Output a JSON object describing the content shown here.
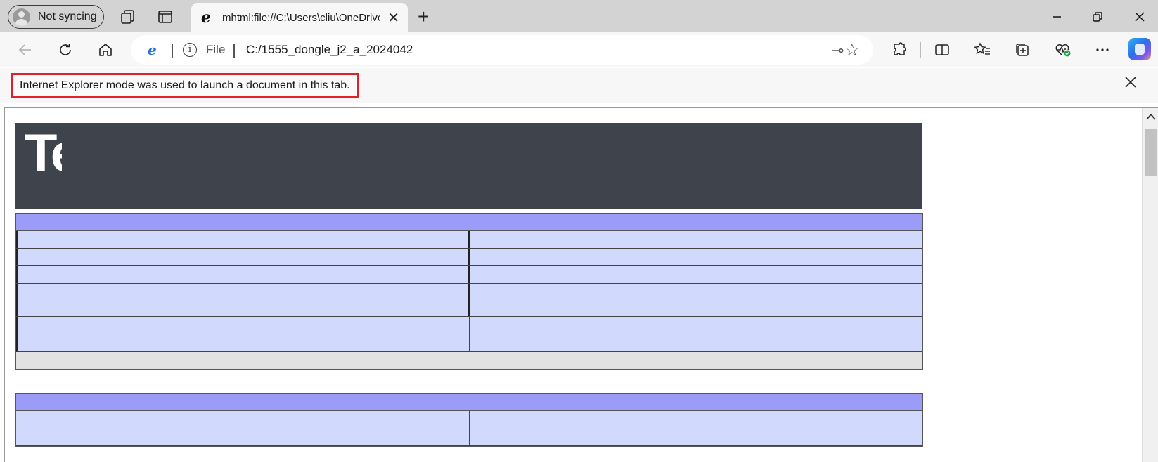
{
  "browser": {
    "profile_label": "Not syncing",
    "tab": {
      "title": "mhtml:file://C:\\Users\\cliu\\OneDrive",
      "close_glyph": "✕"
    },
    "new_tab_glyph": "+",
    "window_controls": {
      "minimize": "—",
      "restore": "❐",
      "close": "✕"
    },
    "address_bar": {
      "scheme_label": "File",
      "url": "C:/​1555_dongle_j2_a_2024042",
      "info_glyph": "i"
    },
    "toolbar_icons": [
      "back-icon",
      "refresh-icon",
      "home-icon",
      "extensions-icon",
      "split-screen-icon",
      "favorites-icon",
      "collections-icon",
      "browser-essentials-icon",
      "more-icon",
      "copilot-icon"
    ]
  },
  "infobar": {
    "message": "Internet Explorer mode was used to launch a document in this tab.",
    "close_glyph": "✕",
    "highlight_color": "#e0202a"
  },
  "page": {
    "banner_logo_text": "Te",
    "banner_color": "#3f434b",
    "table_header_color": "#9a9cf8",
    "table_cell_color": "#d1d9fc",
    "table_footer_color": "#e2e2e2"
  }
}
